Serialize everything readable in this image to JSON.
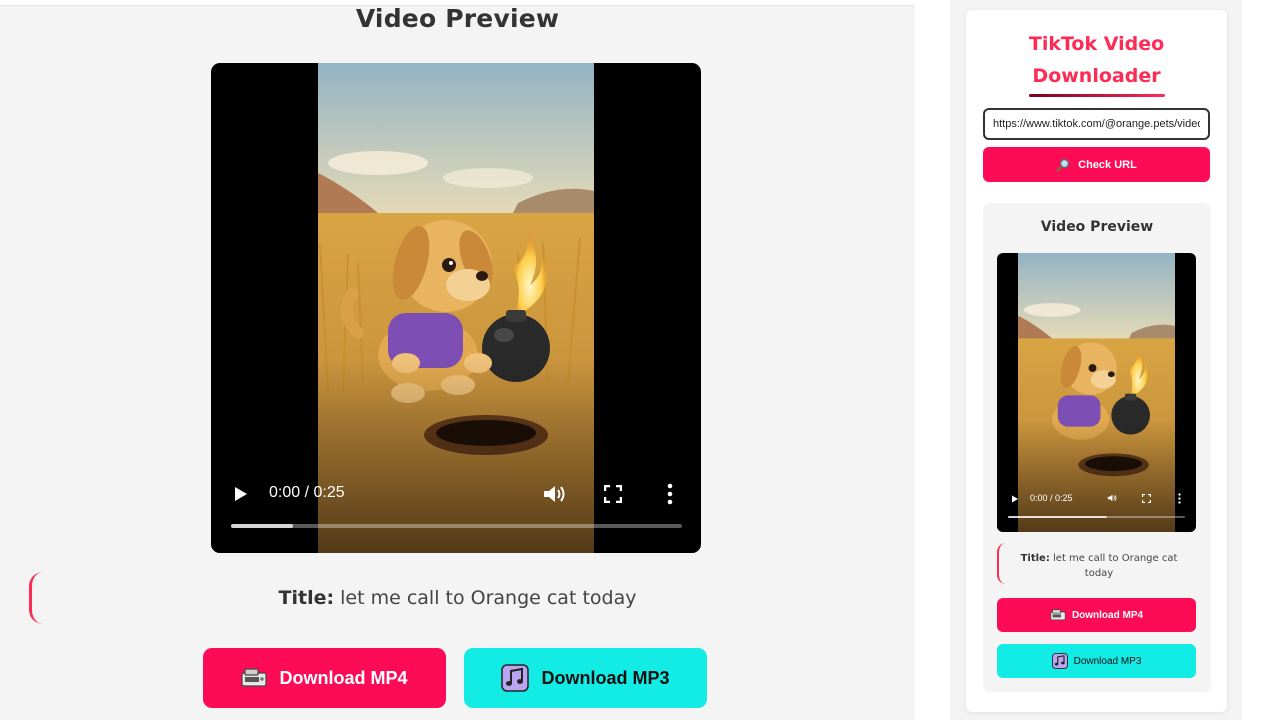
{
  "app": {
    "title": "TikTok Video Downloader",
    "brand_color": "#fe2c55"
  },
  "search": {
    "url_value": "https://www.tiktok.com/@orange.pets/video",
    "check_label": "Check URL",
    "check_icon": "magnifier-icon"
  },
  "preview": {
    "heading": "Video Preview",
    "player": {
      "time_display": "0:00 / 0:25",
      "current_time": "0:00",
      "duration": "0:25",
      "state": "paused"
    },
    "caption_label": "Title:",
    "caption_text": "let me call to Orange cat today"
  },
  "downloads": {
    "mp4_label": "Download MP4",
    "mp4_icon": "video-camera-icon",
    "mp4_color": "#fe0b57",
    "mp3_label": "Download MP3",
    "mp3_icon": "music-note-icon",
    "mp3_color": "#13ebe5"
  }
}
